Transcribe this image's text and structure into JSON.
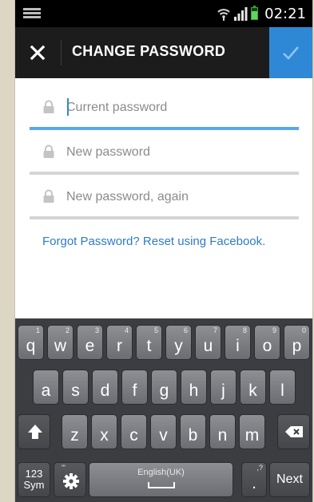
{
  "status_bar": {
    "time": "02:21",
    "icons": [
      "keyboard-notification-icon",
      "wifi-icon",
      "signal-icon",
      "battery-icon"
    ]
  },
  "action_bar": {
    "title": "CHANGE PASSWORD",
    "close_icon": "close-icon",
    "confirm_icon": "checkmark-icon"
  },
  "form": {
    "fields": [
      {
        "placeholder": "Current password",
        "value": "",
        "focused": true
      },
      {
        "placeholder": "New password",
        "value": ""
      },
      {
        "placeholder": "New password, again",
        "value": ""
      }
    ],
    "forgot_link": "Forgot Password? Reset using Facebook."
  },
  "keyboard": {
    "row1": [
      {
        "key": "q",
        "num": "1"
      },
      {
        "key": "w",
        "num": "2"
      },
      {
        "key": "e",
        "num": "3"
      },
      {
        "key": "r",
        "num": "4"
      },
      {
        "key": "t",
        "num": "5"
      },
      {
        "key": "y",
        "num": "6"
      },
      {
        "key": "u",
        "num": "7"
      },
      {
        "key": "i",
        "num": "8"
      },
      {
        "key": "o",
        "num": "9"
      },
      {
        "key": "p",
        "num": "0"
      }
    ],
    "row2": [
      "a",
      "s",
      "d",
      "f",
      "g",
      "h",
      "j",
      "k",
      "l"
    ],
    "row3": [
      "z",
      "x",
      "c",
      "v",
      "b",
      "n",
      "m"
    ],
    "sym_line1": "123",
    "sym_line2": "Sym",
    "settings_sub": "\"'",
    "language": "English(UK)",
    "period": ".",
    "period_sub": ",?",
    "next": "Next",
    "shift_icon": "shift-icon",
    "backspace_icon": "backspace-icon",
    "settings_icon": "gear-icon"
  },
  "colors": {
    "accent": "#2f88d6",
    "action_bar": "#1c1c1c",
    "link": "#2f7bc4",
    "keyboard_bg": "#3c3d40"
  }
}
